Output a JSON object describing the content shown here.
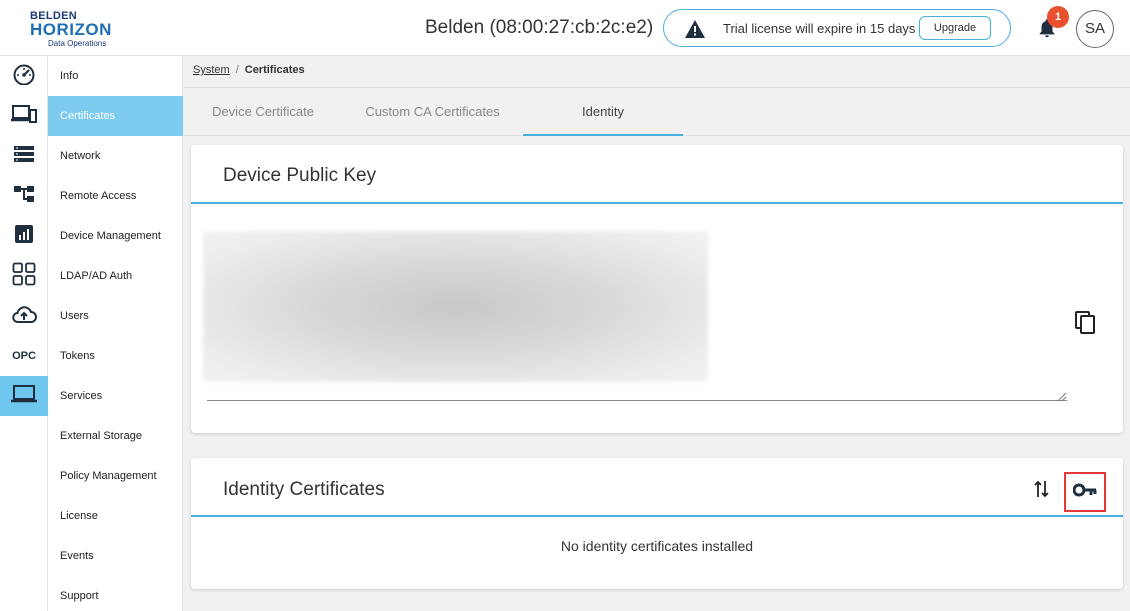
{
  "brand": {
    "line1": "BELDEN",
    "line2": "HORIZON",
    "line3": "Data Operations"
  },
  "header": {
    "device_title": "Belden (08:00:27:cb:2c:e2)",
    "trial_message": "Trial license will expire in 15 days",
    "upgrade_label": "Upgrade",
    "notification_count": "1",
    "avatar_initials": "SA"
  },
  "rail": {
    "items": [
      {
        "icon": "dashboard-gauge-icon"
      },
      {
        "icon": "devices-icon"
      },
      {
        "icon": "storage-list-icon"
      },
      {
        "icon": "hierarchy-icon"
      },
      {
        "icon": "chart-icon"
      },
      {
        "icon": "apps-grid-icon"
      },
      {
        "icon": "cloud-upload-icon"
      },
      {
        "label": "OPC"
      },
      {
        "icon": "laptop-icon",
        "active": true
      }
    ]
  },
  "nav": {
    "items": [
      {
        "label": "Info"
      },
      {
        "label": "Certificates",
        "active": true
      },
      {
        "label": "Network"
      },
      {
        "label": "Remote Access"
      },
      {
        "label": "Device Management"
      },
      {
        "label": "LDAP/AD Auth"
      },
      {
        "label": "Users"
      },
      {
        "label": "Tokens"
      },
      {
        "label": "Services"
      },
      {
        "label": "External Storage"
      },
      {
        "label": "Policy Management"
      },
      {
        "label": "License"
      },
      {
        "label": "Events"
      },
      {
        "label": "Support"
      }
    ]
  },
  "breadcrumb": {
    "parent": "System",
    "separator": "/",
    "current": "Certificates"
  },
  "tabs": [
    {
      "label": "Device Certificate"
    },
    {
      "label": "Custom CA Certificates"
    },
    {
      "label": "Identity",
      "active": true
    }
  ],
  "public_key_card": {
    "title": "Device Public Key"
  },
  "identity_card": {
    "title": "Identity Certificates",
    "empty_message": "No identity certificates installed"
  },
  "colors": {
    "accent": "#4aaee0",
    "active_nav": "#7dcbee",
    "badge": "#e8502e",
    "highlight": "#e53935"
  }
}
